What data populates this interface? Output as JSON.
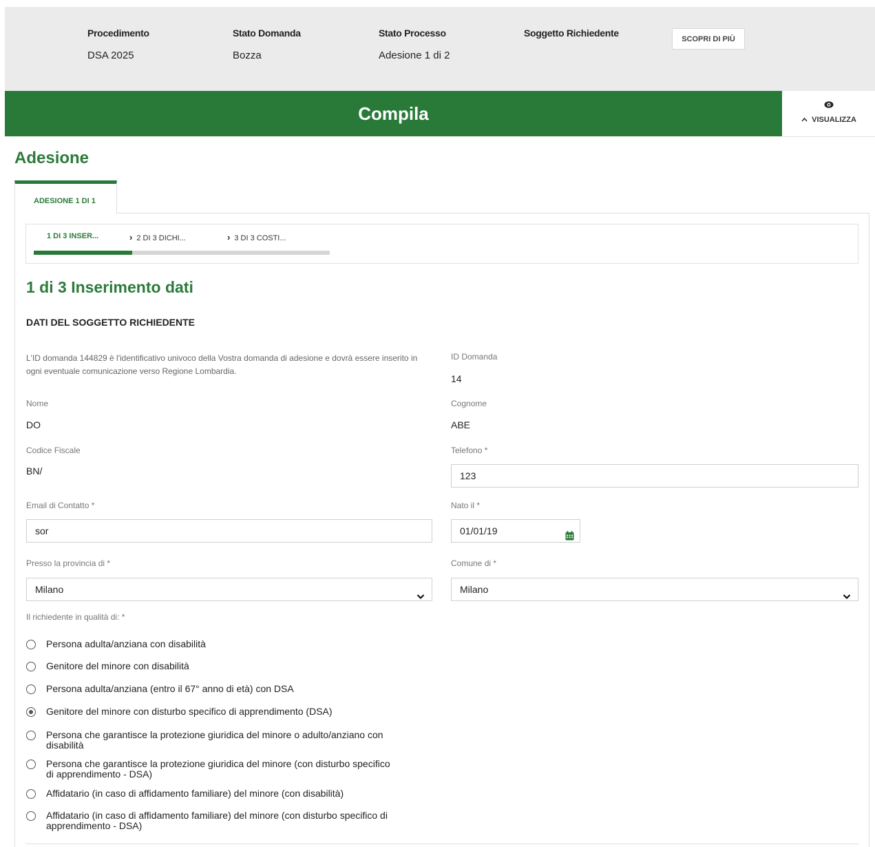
{
  "header": {
    "procedimento_label": "Procedimento",
    "procedimento_value": "DSA 2025",
    "stato_domanda_label": "Stato Domanda",
    "stato_domanda_value": "Bozza",
    "stato_processo_label": "Stato Processo",
    "stato_processo_value": "Adesione 1 di 2",
    "soggetto_label": "Soggetto Richiedente",
    "soggetto_value": "",
    "scopri_label": "SCOPRI DI PIÙ"
  },
  "banner": {
    "title": "Compila",
    "visualizza_label": "VISUALIZZA"
  },
  "page": {
    "title": "Adesione",
    "tab_label": "ADESIONE 1 DI 1"
  },
  "stepper": {
    "steps": [
      "1 DI 3 INSER...",
      "2 DI 3 DICHI...",
      "3 DI 3 COSTI..."
    ],
    "progress": 0.333
  },
  "form": {
    "step_title": "1 di 3 Inserimento dati",
    "section_title": "DATI DEL SOGGETTO RICHIEDENTE",
    "info_text": "L'ID domanda 144829 è l'identificativo univoco della Vostra domanda di adesione e dovrà essere inserito in ogni eventuale comunicazione verso Regione Lombardia.",
    "id_domanda_label": "ID Domanda",
    "id_domanda_value": "14",
    "nome_label": "Nome",
    "nome_value": "DO",
    "cognome_label": "Cognome",
    "cognome_value": "ABE",
    "codice_fiscale_label": "Codice Fiscale",
    "codice_fiscale_value": "BN/",
    "telefono_label": "Telefono *",
    "telefono_value": "123",
    "email_label": "Email di Contatto *",
    "email_value": "sor",
    "nato_label": "Nato il *",
    "nato_value": "01/01/19",
    "provincia_label": "Presso la provincia di *",
    "provincia_value": "Milano",
    "comune_label": "Comune di *",
    "comune_value": "Milano",
    "qualita_label": "Il richiedente in qualità di: *",
    "options": [
      "Persona adulta/anziana con disabilità",
      "Genitore del minore con disabilità",
      "Persona adulta/anziana (entro il 67° anno di età) con DSA",
      "Genitore del minore con disturbo specifico di apprendimento (DSA)",
      "Persona che garantisce la protezione giuridica del minore o adulto/anziano con\ndisabilità",
      "Persona che garantisce la protezione giuridica del minore (con disturbo specifico\ndi apprendimento - DSA)",
      "Affidatario (in caso di affidamento familiare) del minore (con disabilità)",
      "Affidatario (in caso di affidamento familiare) del minore (con disturbo specifico di\napprendimento - DSA)"
    ],
    "selected_option_index": 3
  },
  "colors": {
    "brand_green": "#297a38",
    "header_bg": "#ebebeb"
  },
  "icons": {
    "eye": "eye-icon",
    "caret_up": "caret-up-icon",
    "calendar": "calendar-icon",
    "chevron_down": "chevron-down-icon",
    "chevron_right": "chevron-right-icon"
  }
}
